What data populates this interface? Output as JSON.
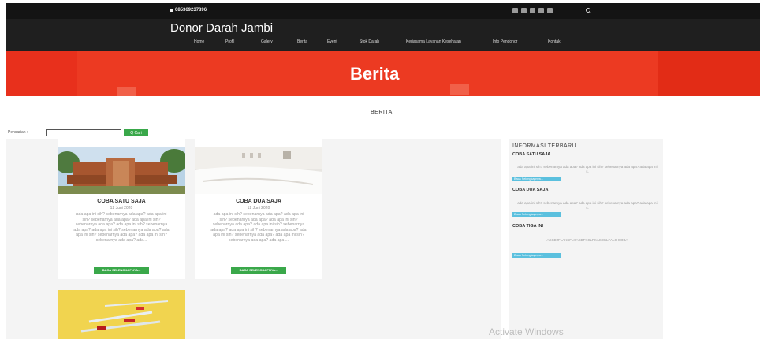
{
  "header": {
    "phone": "085369237896",
    "brand": "Donor Darah Jambi",
    "nav": [
      "Home",
      "Profil",
      "Galery",
      "Berita",
      "Event",
      "Stok Darah",
      "Kerjasama Layanan Kesehatan",
      "Info Pendonor",
      "Kontak"
    ],
    "social_icons": [
      "facebook-icon",
      "twitter-icon",
      "email-icon",
      "google-plus-icon",
      "android-icon"
    ]
  },
  "banner": {
    "title": "Berita"
  },
  "section": {
    "title": "BERITA"
  },
  "search": {
    "label": "Pencarian :",
    "value": "",
    "button": "Q Cari"
  },
  "posts": [
    {
      "title": "COBA SATU SAJA",
      "date": "12 Juni 2020",
      "excerpt": "ada apa ini sih? sebenarnya ada apa? ada apa ini sih? sebenarnya ada apa? ada apa ini sih? sebenarnya ada apa? ada apa ini sih? sebenarnya ada apa? ada apa ini sih? sebenarnya ada apa? ada apa ini sih? sebenarnya ada apa? ada apa ini sih? sebenarnya ada apa? ada...",
      "button": "BACA SELENGKAPNYA..."
    },
    {
      "title": "COBA DUA SAJA",
      "date": "12 Juni 2020",
      "excerpt": "ada apa ini sih? sebenarnya ada apa? ada apa ini sih? sebenarnya ada apa? ada apa ini sih? sebenarnya ada apa? ada apa ini sih? sebenarnya ada apa? ada apa ini sih? sebenarnya ada apa? ada apa ini sih? sebenarnya ada apa? ada apa ini sih? sebenarnya ada apa? ada apa ...",
      "button": "BACA SELENGKAPNYA..."
    }
  ],
  "sidebar": {
    "title": "INFORMASI TERBARU",
    "items": [
      {
        "title": "COBA SATU SAJA",
        "text": "ada apa ini sih? sebenarnya ada apa? ada apa ini sih? sebenarnya ada apa? ada apa ini s.",
        "button": "Baca Selengkapnya..."
      },
      {
        "title": "COBA DUA SAJA",
        "text": "ada apa ini sih? sebenarnya ada apa? ada apa ini sih? sebenarnya ada apa? ada apa ini s.",
        "button": "Baca Selengkapnya..."
      },
      {
        "title": "COBA TIGA INI",
        "text": "AKSDJFLAKSFLKASDFKSLFKASDKLFALS COBA",
        "button": "Baca Selengkapnya..."
      }
    ]
  },
  "watermark": "Activate Windows",
  "colors": {
    "banner": "#ec3a22",
    "header": "#1f1f1f",
    "button_green": "#3aa84a",
    "button_blue": "#5bc0de"
  }
}
